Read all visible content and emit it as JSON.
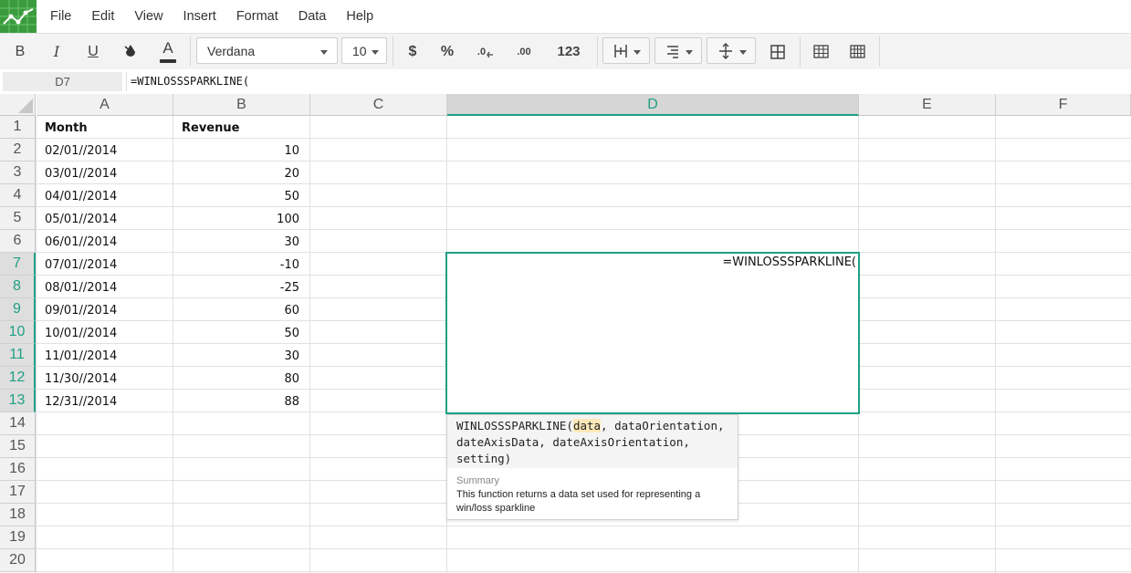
{
  "menu": [
    "File",
    "Edit",
    "View",
    "Insert",
    "Format",
    "Data",
    "Help"
  ],
  "toolbar": {
    "bold": "B",
    "italic": "I",
    "underline": "U",
    "font_color": "A",
    "font_name": "Verdana",
    "font_size": "10",
    "currency": "$",
    "percent": "%",
    "dec_decrease": ".0",
    "dec_increase": ".00",
    "number_format": "123"
  },
  "formula_bar": {
    "name_box": "D7",
    "formula": "=WINLOSSSPARKLINE("
  },
  "columns": [
    "A",
    "B",
    "C",
    "D",
    "E",
    "F"
  ],
  "rows": [
    "1",
    "2",
    "3",
    "4",
    "5",
    "6",
    "7",
    "8",
    "9",
    "10",
    "11",
    "12",
    "13",
    "14",
    "15",
    "16",
    "17",
    "18",
    "19",
    "20"
  ],
  "cells": {
    "header": {
      "a": "Month",
      "b": "Revenue"
    },
    "data": [
      {
        "a": "02/01//2014",
        "b": "10"
      },
      {
        "a": "03/01//2014",
        "b": "20"
      },
      {
        "a": "04/01//2014",
        "b": "50"
      },
      {
        "a": "05/01//2014",
        "b": "100"
      },
      {
        "a": "06/01//2014",
        "b": "30"
      },
      {
        "a": "07/01//2014",
        "b": "-10"
      },
      {
        "a": "08/01//2014",
        "b": "-25"
      },
      {
        "a": "09/01//2014",
        "b": "60"
      },
      {
        "a": "10/01//2014",
        "b": "50"
      },
      {
        "a": "11/01//2014",
        "b": "30"
      },
      {
        "a": "11/30//2014",
        "b": "80"
      },
      {
        "a": "12/31//2014",
        "b": "88"
      }
    ]
  },
  "editor_text": "=WINLOSSSPARKLINE(",
  "tooltip": {
    "sig_pre": "WINLOSSSPARKLINE(",
    "sig_hl": "data",
    "sig_post": ", dataOrientation,\ndateAxisData, dateAxisOrientation,\nsetting)",
    "summary_label": "Summary",
    "summary": "This function returns a data set used for representing a win/loss sparkline"
  },
  "colors": {
    "accent": "#1f9f85",
    "logo": "#3a9b3d"
  }
}
